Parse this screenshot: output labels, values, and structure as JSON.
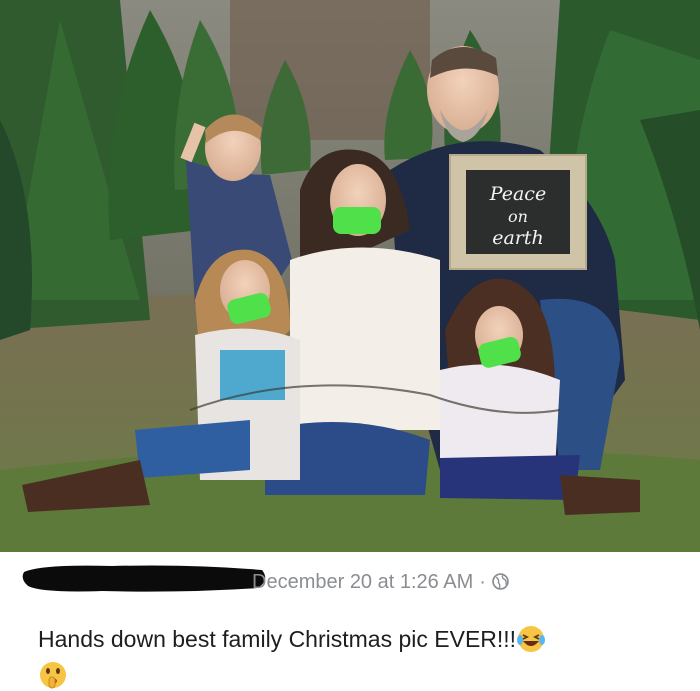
{
  "photo": {
    "alt_subject": "family-photo",
    "sign": {
      "line1": "Peace",
      "line2": "on",
      "line3": "earth"
    }
  },
  "post": {
    "author_redacted": true,
    "timestamp": "December 20 at 1:26 AM",
    "separator": "·",
    "privacy_icon": "globe-icon",
    "caption": "Hands down best family Christmas pic EVER!!!",
    "emoji_1": "laughing-crying-emoji",
    "emoji_2": "shushing-face-emoji"
  },
  "colors": {
    "tape": "#4fe04a",
    "meta_text": "#8a8d91",
    "caption_text": "#1c1e21",
    "chalkboard": "#2b2e2d",
    "frame": "#cfc3a8"
  }
}
